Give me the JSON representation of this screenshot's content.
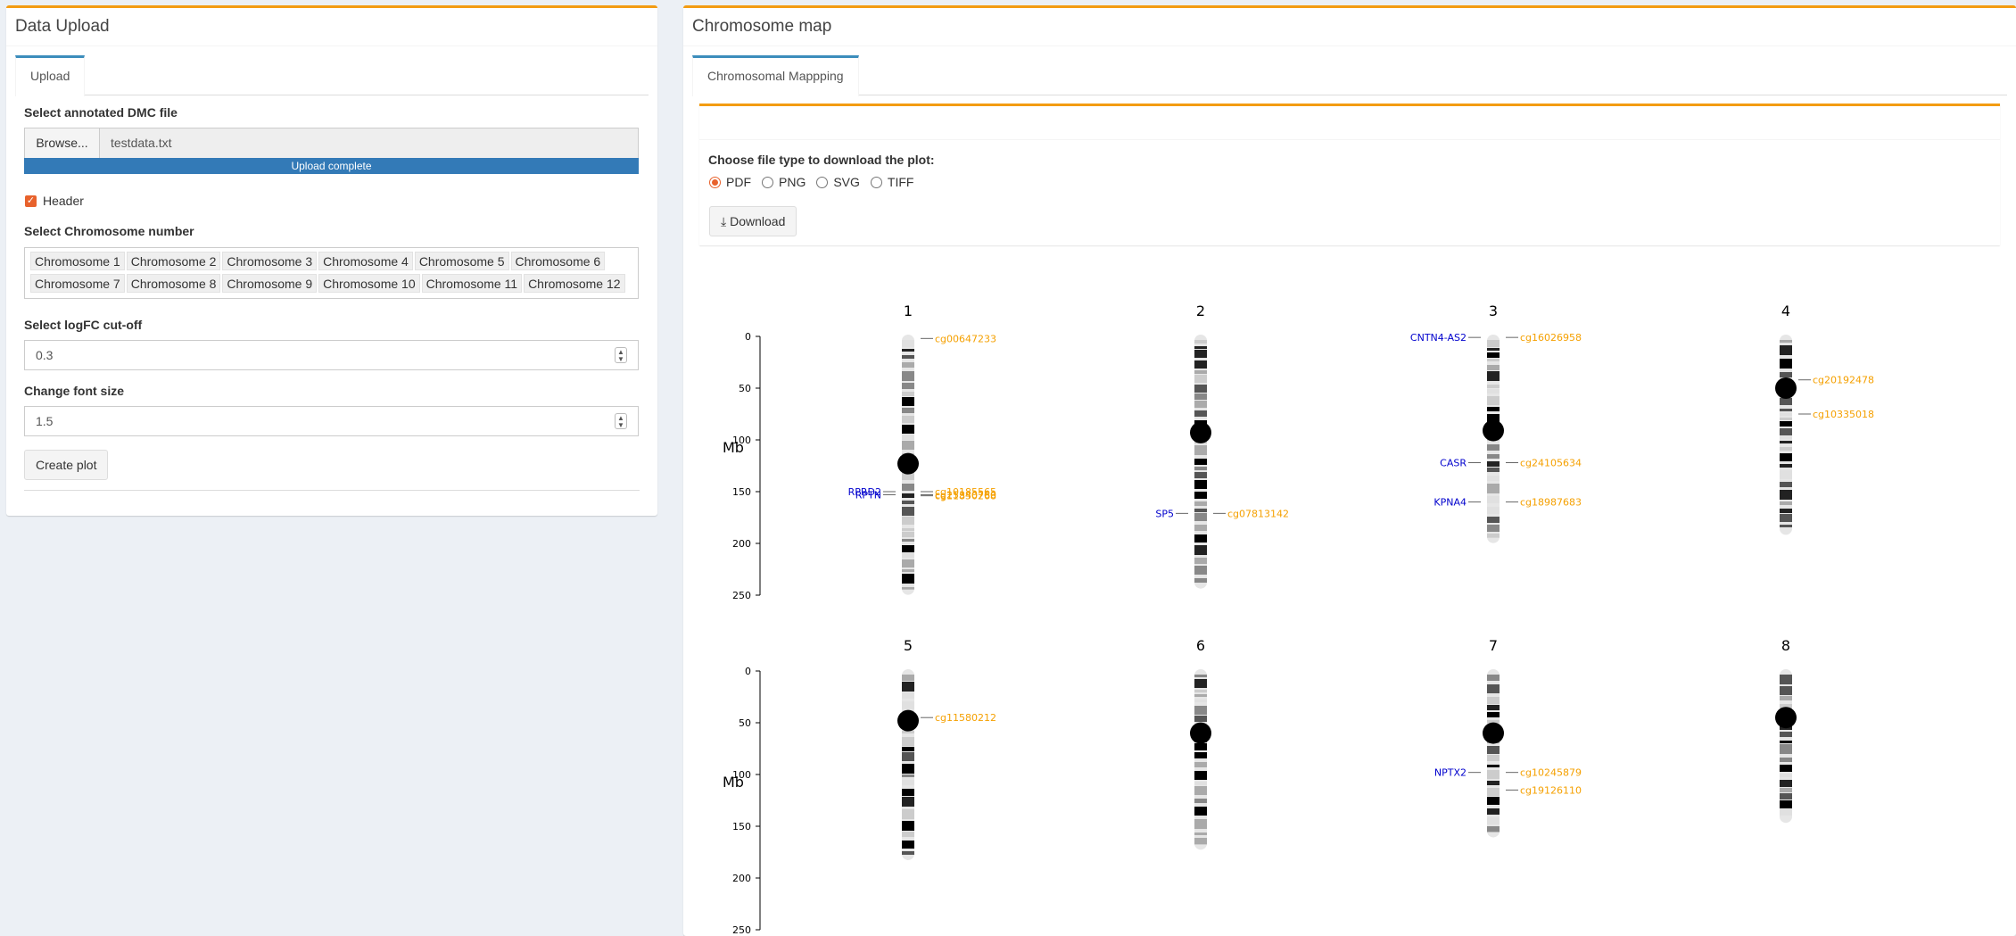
{
  "left_panel": {
    "title": "Data Upload",
    "tab": "Upload",
    "file_label": "Select annotated DMC file",
    "browse_label": "Browse...",
    "file_name": "testdata.txt",
    "progress_text": "Upload complete",
    "header_checkbox_label": "Header",
    "chromosome_label": "Select Chromosome number",
    "chromosomes": [
      "Chromosome 1",
      "Chromosome 2",
      "Chromosome 3",
      "Chromosome 4",
      "Chromosome 5",
      "Chromosome 6",
      "Chromosome 7",
      "Chromosome 8",
      "Chromosome 9",
      "Chromosome 10",
      "Chromosome 11",
      "Chromosome 12"
    ],
    "logfc_label": "Select logFC cut-off",
    "logfc_value": "0.3",
    "font_label": "Change font size",
    "font_value": "1.5",
    "create_button": "Create plot"
  },
  "right_panel": {
    "title": "Chromosome map",
    "tab": "Chromosomal Mappping",
    "download_label": "Choose file type to download the plot:",
    "file_types": [
      "PDF",
      "PNG",
      "SVG",
      "TIFF"
    ],
    "selected_type": "PDF",
    "download_button": "Download"
  },
  "colors": {
    "gene": "#0000cd",
    "cpg": "#f5a000",
    "accent": "#f39c12",
    "tab": "#3c8dbc",
    "progress": "#337ab7",
    "radio": "#e8622c"
  },
  "chart_data": {
    "type": "ideogram",
    "ylabel": "Mb",
    "yticks": [
      0,
      50,
      100,
      150,
      200,
      250
    ],
    "chromosomes": [
      {
        "name": "1",
        "length": 248,
        "centromere": 123,
        "genes": [
          {
            "label": "RPRD2",
            "pos": 150
          },
          {
            "label": "RPTN",
            "pos": 153
          }
        ],
        "cpgs": [
          {
            "label": "cg00647233",
            "pos": 2
          },
          {
            "label": "cg10185565",
            "pos": 150
          },
          {
            "label": "cg25340760",
            "pos": 153
          },
          {
            "label": "cg11850268",
            "pos": 154
          }
        ]
      },
      {
        "name": "2",
        "length": 242,
        "centromere": 93,
        "genes": [
          {
            "label": "SP5",
            "pos": 171
          }
        ],
        "cpgs": [
          {
            "label": "cg07813142",
            "pos": 171
          }
        ]
      },
      {
        "name": "3",
        "length": 198,
        "centromere": 91,
        "genes": [
          {
            "label": "CNTN4-AS2",
            "pos": 1
          },
          {
            "label": "CASR",
            "pos": 122
          },
          {
            "label": "KPNA4",
            "pos": 160
          }
        ],
        "cpgs": [
          {
            "label": "cg16026958",
            "pos": 1
          },
          {
            "label": "cg24105634",
            "pos": 122
          },
          {
            "label": "cg18987683",
            "pos": 160
          }
        ]
      },
      {
        "name": "4",
        "length": 190,
        "centromere": 50,
        "genes": [],
        "cpgs": [
          {
            "label": "cg20192478",
            "pos": 42
          },
          {
            "label": "cg10335018",
            "pos": 75
          }
        ]
      },
      {
        "name": "5",
        "length": 181,
        "centromere": 48,
        "genes": [],
        "cpgs": [
          {
            "label": "cg11580212",
            "pos": 45
          }
        ]
      },
      {
        "name": "6",
        "length": 171,
        "centromere": 60,
        "genes": [],
        "cpgs": []
      },
      {
        "name": "7",
        "length": 159,
        "centromere": 60,
        "genes": [
          {
            "label": "NPTX2",
            "pos": 98
          }
        ],
        "cpgs": [
          {
            "label": "cg10245879",
            "pos": 98
          },
          {
            "label": "cg19126110",
            "pos": 115
          }
        ]
      },
      {
        "name": "8",
        "length": 145,
        "centromere": 45,
        "genes": [],
        "cpgs": []
      }
    ]
  }
}
